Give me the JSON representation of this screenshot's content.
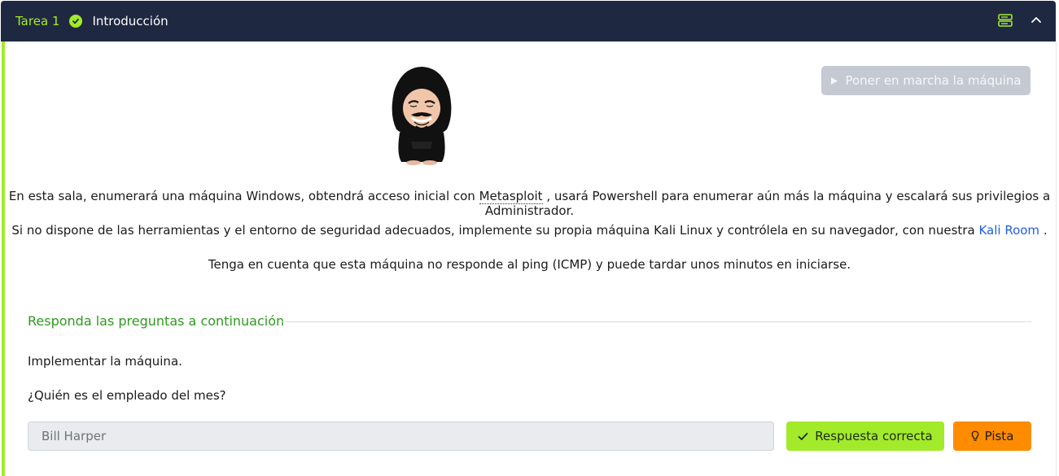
{
  "header": {
    "task_label": "Tarea 1",
    "title": "Introducción",
    "completed_icon": "check-circle-icon",
    "right_icons": [
      "stacked-layout-icon",
      "chevron-up-icon"
    ],
    "accent": "#a3ea2a",
    "background": "#1f2841"
  },
  "start_button": {
    "label": "Poner en marcha la máquina",
    "icon": "play-icon",
    "disabled": true
  },
  "mascot": {
    "name": "hooded-mascot-image"
  },
  "intro": {
    "p1_before": "En esta sala, enumerará una máquina Windows, obtendrá acceso inicial con",
    "p1_abbr": "Metasploit",
    "p1_after": ", usará Powershell para enumerar aún más la máquina y escalará sus privilegios a Administrador.",
    "p2_before": "Si no dispone de las herramientas y el entorno de seguridad adecuados, implemente su propia máquina Kali Linux y contrólela en su navegador, con nuestra",
    "p2_link": "Kali Room",
    "p2_after": ".",
    "p3": "Tenga en cuenta que esta máquina no responde al ping (ICMP) y puede tardar unos minutos en iniciarse."
  },
  "questions": {
    "heading": "Responda las preguntas a continuación",
    "q1": "Implementar la máquina.",
    "q2": "¿Quién es el empleado del mes?",
    "answer_value": "Bill Harper",
    "correct_label": "Respuesta correcta",
    "hint_label": "Pista",
    "colors": {
      "correct": "#a3ea2a",
      "hint": "#ff8c00",
      "heading": "#2e9a1e"
    }
  }
}
